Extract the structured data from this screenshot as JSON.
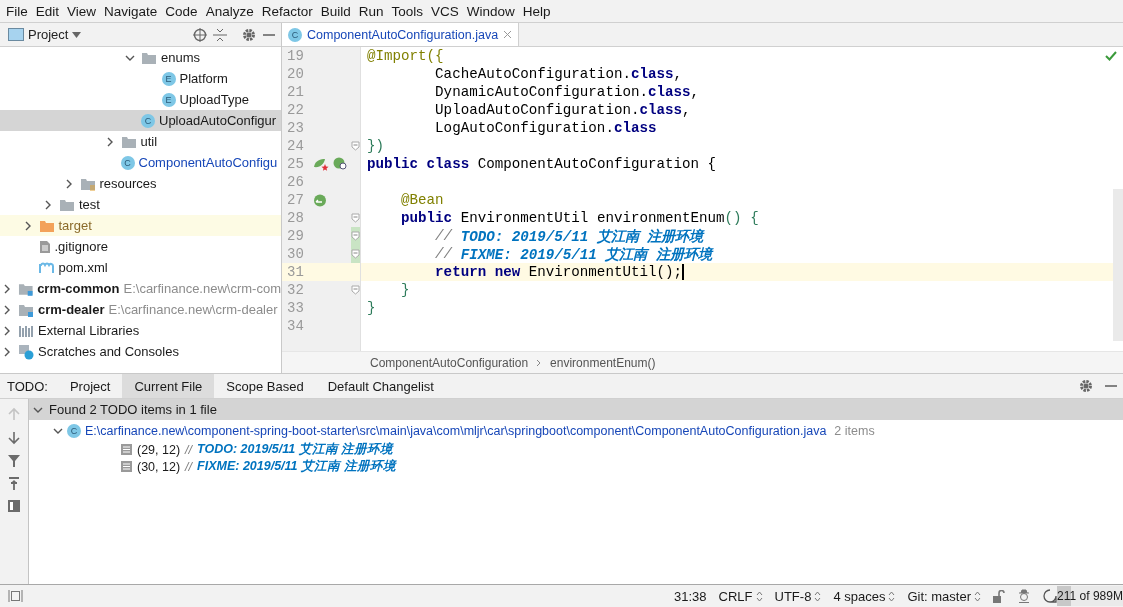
{
  "menu": [
    "File",
    "Edit",
    "View",
    "Navigate",
    "Code",
    "Analyze",
    "Refactor",
    "Build",
    "Run",
    "Tools",
    "VCS",
    "Window",
    "Help"
  ],
  "project_panel": {
    "title": "Project",
    "tree": [
      {
        "children": [
          {
            "children": [
              {
                "children": [
                  {
                    "children": [
                      {
                        "children": [
                          {
                            "children": [
                              {
                                "label": "enums",
                                "kind": "folder",
                                "expanded": true,
                                "selected": false,
                                "children": [
                                  {
                                    "label": "Platform",
                                    "kind": "enum",
                                    "icon_letter": "E",
                                    "selected": false
                                  },
                                  {
                                    "label": "UploadType",
                                    "kind": "enum",
                                    "icon_letter": "E",
                                    "selected": false
                                  }
                                ]
                              },
                              {
                                "label": "UploadAutoConfigur",
                                "kind": "class",
                                "icon_letter": "C",
                                "selected": true
                              }
                            ]
                          },
                          {
                            "label": "util",
                            "kind": "folder",
                            "expanded": false,
                            "selected": false
                          },
                          {
                            "label": "ComponentAutoConfigu",
                            "kind": "class-open",
                            "icon_letter": "C",
                            "selected": false
                          }
                        ]
                      }
                    ]
                  },
                  {
                    "label": "resources",
                    "kind": "resources-folder",
                    "expanded": false,
                    "selected": false
                  }
                ]
              },
              {
                "label": "test",
                "kind": "folder",
                "expanded": false,
                "selected": false
              }
            ]
          },
          {
            "label": "target",
            "kind": "excluded-folder",
            "expanded": false,
            "selected": false
          },
          {
            "label": ".gitignore",
            "kind": "file",
            "selected": false
          },
          {
            "label": "pom.xml",
            "kind": "maven",
            "selected": false
          }
        ]
      },
      {
        "label": "crm-common",
        "kind": "module",
        "hint": "E:\\carfinance.new\\crm-com",
        "expanded": false,
        "selected": false
      },
      {
        "label": "crm-dealer",
        "kind": "module",
        "hint": "E:\\carfinance.new\\crm-dealer",
        "expanded": false,
        "selected": false
      },
      {
        "label": "External Libraries",
        "kind": "libraries",
        "expanded": false,
        "selected": false
      },
      {
        "label": "Scratches and Consoles",
        "kind": "scratches",
        "expanded": false,
        "selected": false
      }
    ]
  },
  "editor": {
    "tab": {
      "label": "ComponentAutoConfiguration.java",
      "icon_letter": "C",
      "selected": true
    },
    "lines": [
      {
        "number": "19",
        "current": false,
        "fold": false,
        "changed": false,
        "tokens": [
          {
            "kind": "annotation",
            "text": "@Import"
          },
          {
            "kind": "annotation",
            "text": "({"
          }
        ]
      },
      {
        "number": "20",
        "current": false,
        "fold": false,
        "changed": false,
        "tokens": [
          {
            "kind": "plain",
            "text": "        CacheAutoConfiguration."
          },
          {
            "kind": "keyword",
            "text": "class"
          },
          {
            "kind": "plain",
            "text": ","
          }
        ]
      },
      {
        "number": "21",
        "current": false,
        "fold": false,
        "changed": false,
        "tokens": [
          {
            "kind": "plain",
            "text": "        DynamicAutoConfiguration."
          },
          {
            "kind": "keyword",
            "text": "class"
          },
          {
            "kind": "plain",
            "text": ","
          }
        ]
      },
      {
        "number": "22",
        "current": false,
        "fold": false,
        "changed": false,
        "tokens": [
          {
            "kind": "plain",
            "text": "        UploadAutoConfiguration."
          },
          {
            "kind": "keyword",
            "text": "class"
          },
          {
            "kind": "plain",
            "text": ","
          }
        ]
      },
      {
        "number": "23",
        "current": false,
        "fold": false,
        "changed": false,
        "tokens": [
          {
            "kind": "plain",
            "text": "        LogAutoConfiguration."
          },
          {
            "kind": "keyword",
            "text": "class"
          }
        ]
      },
      {
        "number": "24",
        "current": false,
        "fold": true,
        "changed": false,
        "tokens": [
          {
            "kind": "punct",
            "text": "})"
          }
        ]
      },
      {
        "number": "25",
        "current": false,
        "fold": false,
        "changed": false,
        "gutter": [
          {
            "kind": "bean-class"
          },
          {
            "kind": "bean-search"
          }
        ],
        "tokens": [
          {
            "kind": "keyword",
            "text": "public class"
          },
          {
            "kind": "plain",
            "text": " ComponentAutoConfiguration {"
          }
        ]
      },
      {
        "number": "26",
        "current": false,
        "fold": false,
        "changed": false
      },
      {
        "number": "27",
        "current": false,
        "fold": false,
        "changed": false,
        "gutter": [
          {
            "kind": "bean-method"
          }
        ],
        "tokens": [
          {
            "kind": "annotation",
            "text": "    @Bean"
          }
        ]
      },
      {
        "number": "28",
        "current": false,
        "fold": true,
        "changed": false,
        "tokens": [
          {
            "kind": "keyword",
            "text": "    public"
          },
          {
            "kind": "plain",
            "text": " EnvironmentUtil environmentEnum"
          },
          {
            "kind": "punct",
            "text": "() {"
          }
        ]
      },
      {
        "number": "29",
        "current": false,
        "fold": true,
        "changed": true,
        "tokens": [
          {
            "kind": "comment",
            "text": "        // "
          },
          {
            "kind": "todo",
            "text": "TODO: 2019/5/11 艾江南 注册环境"
          }
        ]
      },
      {
        "number": "30",
        "current": false,
        "fold": true,
        "changed": true,
        "tokens": [
          {
            "kind": "comment",
            "text": "        // "
          },
          {
            "kind": "todo",
            "text": "FIXME: 2019/5/11 艾江南 注册环境"
          }
        ]
      },
      {
        "number": "31",
        "current": true,
        "fold": false,
        "changed": false,
        "tokens": [
          {
            "kind": "keyword",
            "text": "        return new"
          },
          {
            "kind": "plain",
            "text": " EnvironmentUtil();"
          }
        ]
      },
      {
        "number": "32",
        "current": false,
        "fold": true,
        "changed": false,
        "tokens": [
          {
            "kind": "punct",
            "text": "    }"
          }
        ]
      },
      {
        "number": "33",
        "current": false,
        "fold": false,
        "changed": false,
        "tokens": [
          {
            "kind": "punct",
            "text": "}"
          }
        ]
      },
      {
        "number": "34",
        "current": false,
        "fold": false,
        "changed": false
      }
    ],
    "breadcrumbs": [
      "ComponentAutoConfiguration",
      "environmentEnum()"
    ]
  },
  "todo_panel": {
    "label": "TODO:",
    "tabs": [
      {
        "label": "Project",
        "selected": false
      },
      {
        "label": "Current File",
        "selected": true
      },
      {
        "label": "Scope Based",
        "selected": false
      },
      {
        "label": "Default Changelist",
        "selected": false
      }
    ],
    "toolbar": [
      {
        "kind": "up",
        "disabled": true
      },
      {
        "kind": "down",
        "disabled": false
      },
      {
        "kind": "filter",
        "disabled": false
      },
      {
        "kind": "pin",
        "disabled": false
      },
      {
        "kind": "preview",
        "disabled": false
      }
    ],
    "summary": {
      "text": "Found 2 TODO items in 1 file",
      "expanded": true
    },
    "file": {
      "icon_letter": "C",
      "path": "E:\\carfinance.new\\component-spring-boot-starter\\src\\main\\java\\com\\mljr\\car\\springboot\\component\\ComponentAutoConfiguration.java",
      "count": "2 items",
      "expanded": true
    },
    "items": [
      {
        "position": "(29, 12)",
        "prefix": "//",
        "text": "TODO: 2019/5/11 艾江南 注册环境"
      },
      {
        "position": "(30, 12)",
        "prefix": "//",
        "text": "FIXME: 2019/5/11 艾江南 注册环境"
      }
    ]
  },
  "status_bar": {
    "position": "31:38",
    "line_separator": "CRLF",
    "encoding": "UTF-8",
    "indent": "4 spaces",
    "vcs": "Git: master",
    "memory": {
      "text": "211 of 989M",
      "level": 0.21
    }
  }
}
